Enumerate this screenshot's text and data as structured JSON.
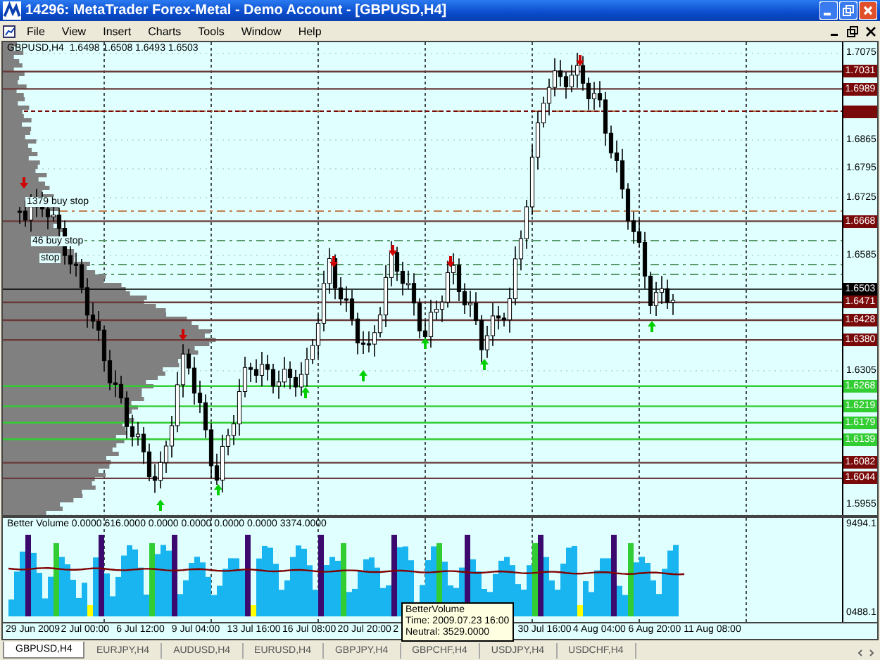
{
  "window": {
    "title": "14296: MetaTrader Forex-Metal - Demo Account - [GBPUSD,H4]"
  },
  "menu": [
    {
      "label": "File"
    },
    {
      "label": "View"
    },
    {
      "label": "Insert"
    },
    {
      "label": "Charts"
    },
    {
      "label": "Tools"
    },
    {
      "label": "Window"
    },
    {
      "label": "Help"
    }
  ],
  "chart": {
    "header": "GBPUSD,H4  1.6498 1.6508 1.6493 1.6503",
    "order_labels": [
      "1379 buy stop",
      "46 buy stop",
      "stop"
    ],
    "price_ticks": [
      "1.7075",
      "1.6865",
      "1.6795",
      "1.6725",
      "1.6585",
      "1.6305",
      "1.5955"
    ],
    "price_tags": [
      {
        "text": "1.7031",
        "kind": "resistance"
      },
      {
        "text": "1.6989",
        "kind": "resistance"
      },
      {
        "text": "1.6668",
        "kind": "resistance"
      },
      {
        "text": "1.6503",
        "kind": "current"
      },
      {
        "text": "1.6471",
        "kind": "resistance"
      },
      {
        "text": "1.6428",
        "kind": "resistance"
      },
      {
        "text": "1.6380",
        "kind": "resistance"
      },
      {
        "text": "1.6268",
        "kind": "support"
      },
      {
        "text": "1.6219",
        "kind": "support"
      },
      {
        "text": "1.6179",
        "kind": "support"
      },
      {
        "text": "1.6139",
        "kind": "support"
      },
      {
        "text": "1.6082",
        "kind": "resistance"
      },
      {
        "text": "1.6044",
        "kind": "resistance"
      }
    ]
  },
  "volume": {
    "header": "Better Volume 0.0000 616.0000 0.0000 0.0000 0.0000 0.0000 3374.0000",
    "axis": [
      "9494.1",
      "0488.1"
    ],
    "tooltip": [
      "BetterVolume",
      "Time: 2009.07.23 16:00",
      "Neutral: 3529.0000"
    ]
  },
  "time_axis": [
    "29 Jun 2009",
    "2 Jul 00:00",
    "6 Jul 12:00",
    "9 Jul 04:00",
    "13 Jul 16:00",
    "16 Jul 08:00",
    "20 Jul 20:00",
    "2",
    "30 Jul 16:00",
    "4 Aug 04:00",
    "6 Aug 20:00",
    "11 Aug 08:00"
  ],
  "tabs": [
    {
      "label": "GBPUSD,H4",
      "selected": true
    },
    {
      "label": "EURJPY,H4",
      "selected": false
    },
    {
      "label": "AUDUSD,H4",
      "selected": false
    },
    {
      "label": "EURUSD,H4",
      "selected": false
    },
    {
      "label": "GBPJPY,H4",
      "selected": false
    },
    {
      "label": "GBPCHF,H4",
      "selected": false
    },
    {
      "label": "USDJPY,H4",
      "selected": false
    },
    {
      "label": "USDCHF,H4",
      "selected": false
    }
  ]
}
